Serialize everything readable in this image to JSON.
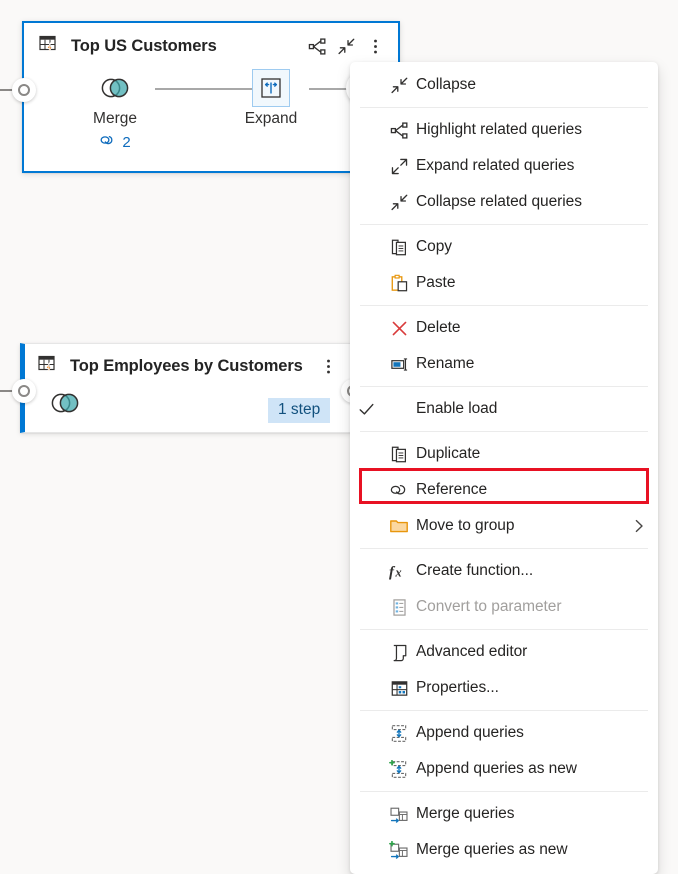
{
  "canvas": {
    "background_color": "#faf9f8",
    "accent_color": "#0078d4",
    "highlight_color": "#e81123"
  },
  "queries": [
    {
      "title": "Top US Customers",
      "selected": true,
      "icon": "table-lightning-icon",
      "header_actions": [
        {
          "name": "highlight-related-queries-icon",
          "label": "Highlight related queries"
        },
        {
          "name": "collapse-icon",
          "label": "Collapse"
        },
        {
          "name": "more-options-icon",
          "label": "More options"
        }
      ],
      "steps": [
        {
          "label": "Merge",
          "icon": "merge-venn-icon",
          "link_count": "2",
          "selected": false
        },
        {
          "label": "Expand",
          "icon": "expand-columns-icon",
          "selected": true
        }
      ],
      "add_step_label": "+"
    },
    {
      "title": "Top Employees by Customers",
      "selected": false,
      "icon": "table-lightning-icon",
      "header_actions": [
        {
          "name": "more-options-icon",
          "label": "More options"
        }
      ],
      "steps": [
        {
          "label": "",
          "icon": "merge-venn-icon"
        }
      ],
      "badge": "1 step"
    }
  ],
  "context_menu": {
    "groups": [
      {
        "items": [
          {
            "id": "collapse",
            "label": "Collapse",
            "icon": "collapse-icon",
            "disabled": false,
            "checked": false,
            "submenu": false
          }
        ]
      },
      {
        "items": [
          {
            "id": "highlight-related-queries",
            "label": "Highlight related queries",
            "icon": "highlight-related-queries-icon",
            "disabled": false,
            "checked": false,
            "submenu": false
          },
          {
            "id": "expand-related-queries",
            "label": "Expand related queries",
            "icon": "expand-related-queries-icon",
            "disabled": false,
            "checked": false,
            "submenu": false
          },
          {
            "id": "collapse-related-queries",
            "label": "Collapse related queries",
            "icon": "collapse-related-queries-icon",
            "disabled": false,
            "checked": false,
            "submenu": false
          }
        ]
      },
      {
        "items": [
          {
            "id": "copy",
            "label": "Copy",
            "icon": "copy-icon",
            "disabled": false,
            "checked": false,
            "submenu": false
          },
          {
            "id": "paste",
            "label": "Paste",
            "icon": "paste-icon",
            "disabled": false,
            "checked": false,
            "submenu": false
          }
        ]
      },
      {
        "items": [
          {
            "id": "delete",
            "label": "Delete",
            "icon": "delete-x-icon",
            "disabled": false,
            "checked": false,
            "submenu": false
          },
          {
            "id": "rename",
            "label": "Rename",
            "icon": "rename-icon",
            "disabled": false,
            "checked": false,
            "submenu": false
          }
        ]
      },
      {
        "items": [
          {
            "id": "enable-load",
            "label": "Enable load",
            "icon": "",
            "disabled": false,
            "checked": true,
            "submenu": false
          }
        ]
      },
      {
        "items": [
          {
            "id": "duplicate",
            "label": "Duplicate",
            "icon": "duplicate-icon",
            "disabled": false,
            "checked": false,
            "submenu": false
          },
          {
            "id": "reference",
            "label": "Reference",
            "icon": "reference-link-icon",
            "disabled": false,
            "checked": false,
            "submenu": false,
            "highlighted": true
          },
          {
            "id": "move-to-group",
            "label": "Move to group",
            "icon": "folder-icon",
            "disabled": false,
            "checked": false,
            "submenu": true
          }
        ]
      },
      {
        "items": [
          {
            "id": "create-function",
            "label": "Create function...",
            "icon": "fx-icon",
            "disabled": false,
            "checked": false,
            "submenu": false
          },
          {
            "id": "convert-to-parameter",
            "label": "Convert to parameter",
            "icon": "parameter-icon",
            "disabled": true,
            "checked": false,
            "submenu": false
          }
        ]
      },
      {
        "items": [
          {
            "id": "advanced-editor",
            "label": "Advanced editor",
            "icon": "advanced-editor-icon",
            "disabled": false,
            "checked": false,
            "submenu": false
          },
          {
            "id": "properties",
            "label": "Properties...",
            "icon": "properties-icon",
            "disabled": false,
            "checked": false,
            "submenu": false
          }
        ]
      },
      {
        "items": [
          {
            "id": "append-queries",
            "label": "Append queries",
            "icon": "append-queries-icon",
            "disabled": false,
            "checked": false,
            "submenu": false
          },
          {
            "id": "append-queries-as-new",
            "label": "Append queries as new",
            "icon": "append-queries-as-new-icon",
            "disabled": false,
            "checked": false,
            "submenu": false
          }
        ]
      },
      {
        "items": [
          {
            "id": "merge-queries",
            "label": "Merge queries",
            "icon": "merge-queries-icon",
            "disabled": false,
            "checked": false,
            "submenu": false
          },
          {
            "id": "merge-queries-as-new",
            "label": "Merge queries as new",
            "icon": "merge-queries-as-new-icon",
            "disabled": false,
            "checked": false,
            "submenu": false
          }
        ]
      }
    ]
  }
}
